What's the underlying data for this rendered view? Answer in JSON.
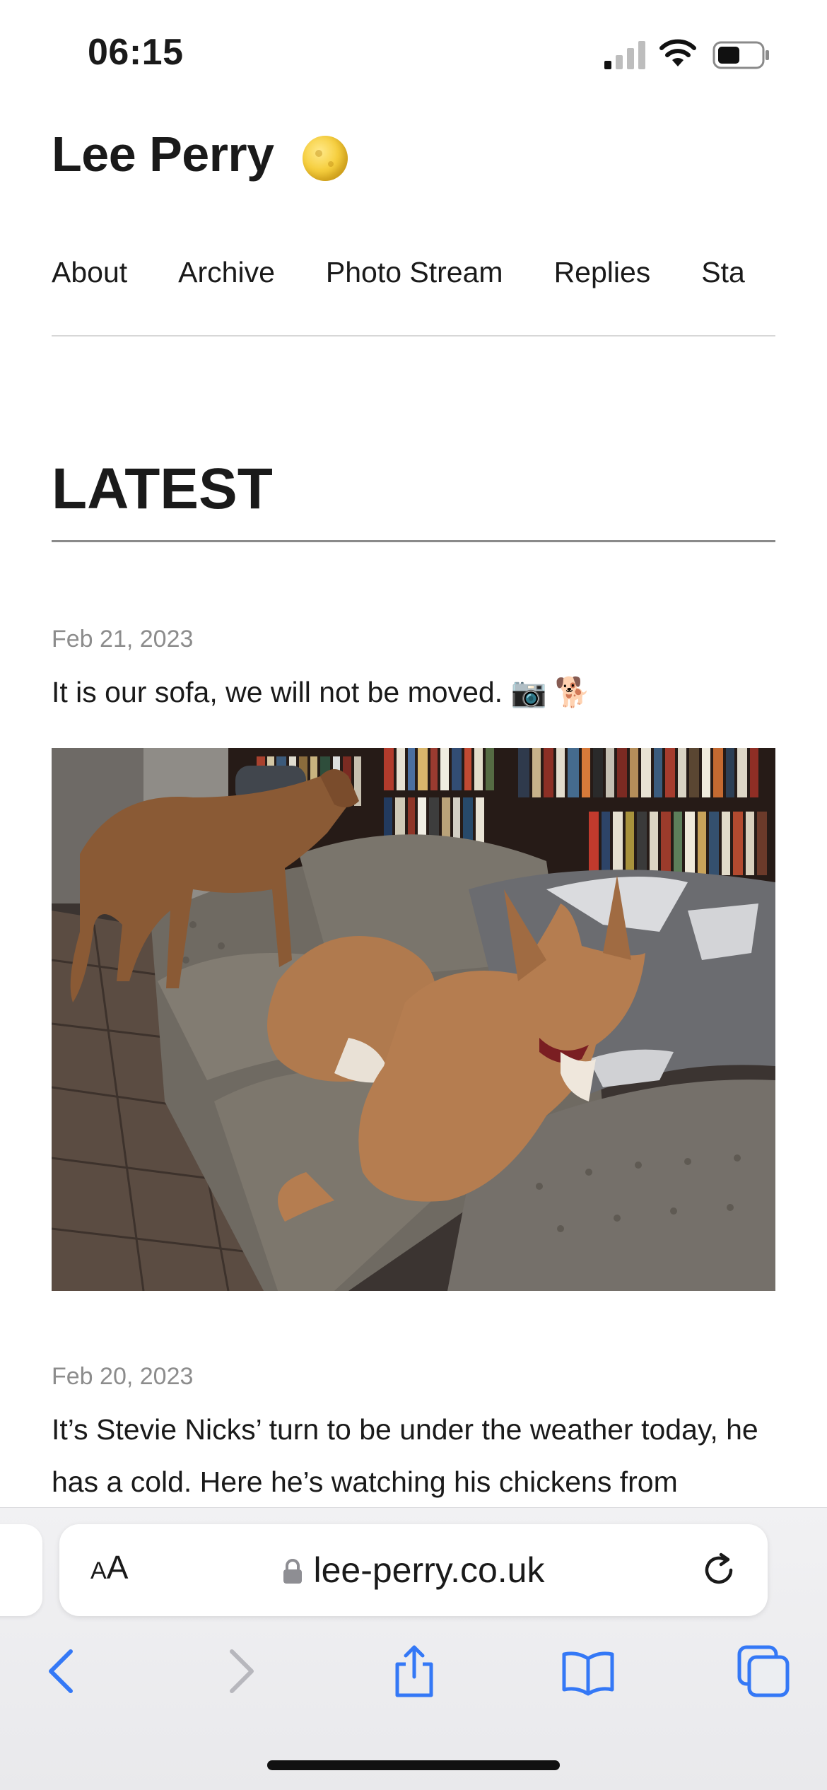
{
  "status_bar": {
    "time": "06:15"
  },
  "site": {
    "title": "Lee Perry",
    "title_emoji": "moon-icon"
  },
  "nav": {
    "items": [
      "About",
      "Archive",
      "Photo Stream",
      "Replies",
      "Sta"
    ]
  },
  "section": {
    "heading": "LATEST"
  },
  "posts": [
    {
      "date": "Feb 21, 2023",
      "text": "It is our sofa, we will not be moved. 📷 🐕",
      "photo": "dogs-on-sofa-photo"
    },
    {
      "date": "Feb 20, 2023",
      "text": "It’s Stevie Nicks’ turn to be under the weather today, he has a cold. Here he’s watching his chickens from"
    }
  ],
  "browser": {
    "aa_label_small": "A",
    "aa_label_large": "A",
    "url": "lee-perry.co.uk",
    "accent": "#3478f6"
  }
}
